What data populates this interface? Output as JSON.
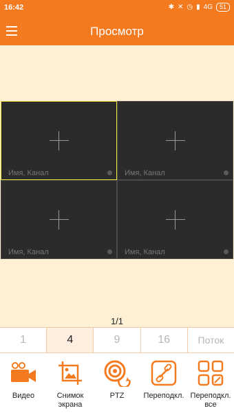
{
  "status": {
    "time": "16:42",
    "network": "4G",
    "battery": "51"
  },
  "header": {
    "title": "Просмотр"
  },
  "grid": {
    "cells": [
      {
        "label": "Имя, Канал"
      },
      {
        "label": "Имя, Канал"
      },
      {
        "label": "Имя, Канал"
      },
      {
        "label": "Имя, Канал"
      }
    ]
  },
  "pagination": {
    "text": "1/1"
  },
  "layout_tabs": {
    "items": [
      "1",
      "4",
      "9",
      "16",
      "Поток"
    ],
    "active": "4"
  },
  "toolbar": {
    "video": "Видео",
    "snapshot": "Снимок экрана",
    "ptz": "PTZ",
    "reconnect": "Переподкл.",
    "reconnect_all": "Переподкл. все"
  },
  "colors": {
    "accent": "#f47a20",
    "background": "#fdf0d5",
    "selected_border": "#f2e23a"
  }
}
